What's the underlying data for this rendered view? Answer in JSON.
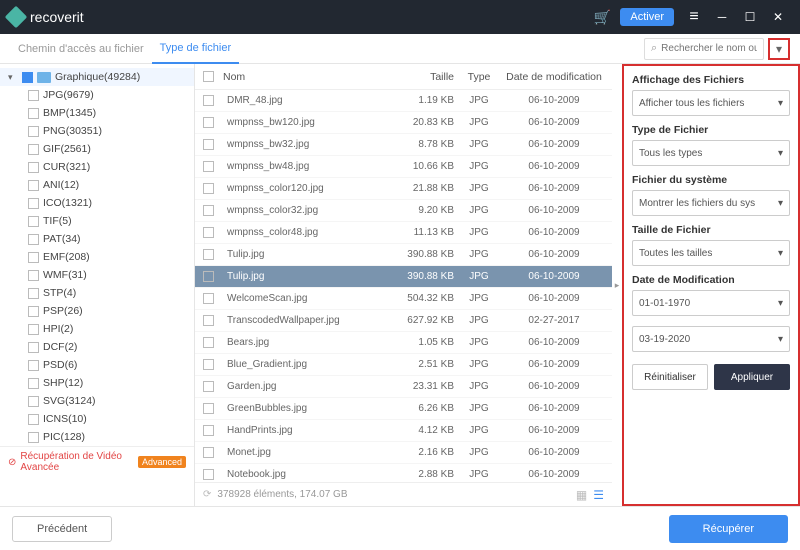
{
  "titlebar": {
    "brand": "recoverit",
    "activer": "Activer"
  },
  "tabs": {
    "path": "Chemin d'accès au fichier",
    "type": "Type de fichier"
  },
  "search": {
    "placeholder": "Rechercher le nom ou l..."
  },
  "sidebar": {
    "root": "Graphique(49284)",
    "items": [
      {
        "label": "JPG(9679)"
      },
      {
        "label": "BMP(1345)"
      },
      {
        "label": "PNG(30351)"
      },
      {
        "label": "GIF(2561)"
      },
      {
        "label": "CUR(321)"
      },
      {
        "label": "ANI(12)"
      },
      {
        "label": "ICO(1321)"
      },
      {
        "label": "TIF(5)"
      },
      {
        "label": "PAT(34)"
      },
      {
        "label": "EMF(208)"
      },
      {
        "label": "WMF(31)"
      },
      {
        "label": "STP(4)"
      },
      {
        "label": "PSP(26)"
      },
      {
        "label": "HPI(2)"
      },
      {
        "label": "DCF(2)"
      },
      {
        "label": "PSD(6)"
      },
      {
        "label": "SHP(12)"
      },
      {
        "label": "SVG(3124)"
      },
      {
        "label": "ICNS(10)"
      },
      {
        "label": "PIC(128)"
      }
    ],
    "adv": "Récupération de Vidéo Avancée",
    "adv_badge": "Advanced"
  },
  "table": {
    "headers": {
      "name": "Nom",
      "size": "Taille",
      "type": "Type",
      "date": "Date de modification"
    },
    "rows": [
      {
        "name": "DMR_48.jpg",
        "size": "1.19 KB",
        "type": "JPG",
        "date": "06-10-2009",
        "sel": false
      },
      {
        "name": "wmpnss_bw120.jpg",
        "size": "20.83 KB",
        "type": "JPG",
        "date": "06-10-2009",
        "sel": false
      },
      {
        "name": "wmpnss_bw32.jpg",
        "size": "8.78 KB",
        "type": "JPG",
        "date": "06-10-2009",
        "sel": false
      },
      {
        "name": "wmpnss_bw48.jpg",
        "size": "10.66 KB",
        "type": "JPG",
        "date": "06-10-2009",
        "sel": false
      },
      {
        "name": "wmpnss_color120.jpg",
        "size": "21.88 KB",
        "type": "JPG",
        "date": "06-10-2009",
        "sel": false
      },
      {
        "name": "wmpnss_color32.jpg",
        "size": "9.20 KB",
        "type": "JPG",
        "date": "06-10-2009",
        "sel": false
      },
      {
        "name": "wmpnss_color48.jpg",
        "size": "11.13 KB",
        "type": "JPG",
        "date": "06-10-2009",
        "sel": false
      },
      {
        "name": "Tulip.jpg",
        "size": "390.88 KB",
        "type": "JPG",
        "date": "06-10-2009",
        "sel": false
      },
      {
        "name": "Tulip.jpg",
        "size": "390.88 KB",
        "type": "JPG",
        "date": "06-10-2009",
        "sel": true
      },
      {
        "name": "WelcomeScan.jpg",
        "size": "504.32 KB",
        "type": "JPG",
        "date": "06-10-2009",
        "sel": false
      },
      {
        "name": "TranscodedWallpaper.jpg",
        "size": "627.92 KB",
        "type": "JPG",
        "date": "02-27-2017",
        "sel": false
      },
      {
        "name": "Bears.jpg",
        "size": "1.05 KB",
        "type": "JPG",
        "date": "06-10-2009",
        "sel": false
      },
      {
        "name": "Blue_Gradient.jpg",
        "size": "2.51 KB",
        "type": "JPG",
        "date": "06-10-2009",
        "sel": false
      },
      {
        "name": "Garden.jpg",
        "size": "23.31 KB",
        "type": "JPG",
        "date": "06-10-2009",
        "sel": false
      },
      {
        "name": "GreenBubbles.jpg",
        "size": "6.26 KB",
        "type": "JPG",
        "date": "06-10-2009",
        "sel": false
      },
      {
        "name": "HandPrints.jpg",
        "size": "4.12 KB",
        "type": "JPG",
        "date": "06-10-2009",
        "sel": false
      },
      {
        "name": "Monet.jpg",
        "size": "2.16 KB",
        "type": "JPG",
        "date": "06-10-2009",
        "sel": false
      },
      {
        "name": "Notebook.jpg",
        "size": "2.88 KB",
        "type": "JPG",
        "date": "06-10-2009",
        "sel": false
      }
    ],
    "status": "378928 éléments, 174.07 GB"
  },
  "filter": {
    "display": {
      "label": "Affichage des Fichiers",
      "value": "Afficher tous les fichiers"
    },
    "type": {
      "label": "Type de Fichier",
      "value": "Tous les types"
    },
    "system": {
      "label": "Fichier du système",
      "value": "Montrer les fichiers du sys"
    },
    "size": {
      "label": "Taille de Fichier",
      "value": "Toutes les tailles"
    },
    "date": {
      "label": "Date de Modification",
      "from": "01-01-1970",
      "to": "03-19-2020"
    },
    "reset": "Réinitialiser",
    "apply": "Appliquer"
  },
  "footer": {
    "prev": "Précédent",
    "recover": "Récupérer"
  }
}
